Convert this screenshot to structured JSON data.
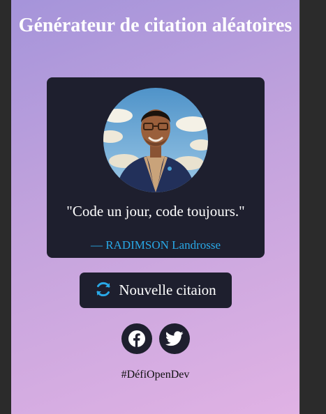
{
  "app": {
    "title": "Générateur de citation aléatoires"
  },
  "quote_card": {
    "avatar_icon": "developer-avatar",
    "quote": "\"Code un jour, code toujours.\"",
    "author": "— RADIMSON Landrosse"
  },
  "actions": {
    "new_quote_icon": "refresh-icon",
    "new_quote_label": "Nouvelle citaion"
  },
  "socials": [
    {
      "name": "facebook-icon"
    },
    {
      "name": "twitter-icon"
    }
  ],
  "footer": {
    "hashtag": "#DéfiOpenDev"
  },
  "colors": {
    "card_bg": "#1e1f2e",
    "author": "#29a8e6",
    "gradient_start": "#a594da",
    "gradient_end": "#e0b2e4"
  }
}
